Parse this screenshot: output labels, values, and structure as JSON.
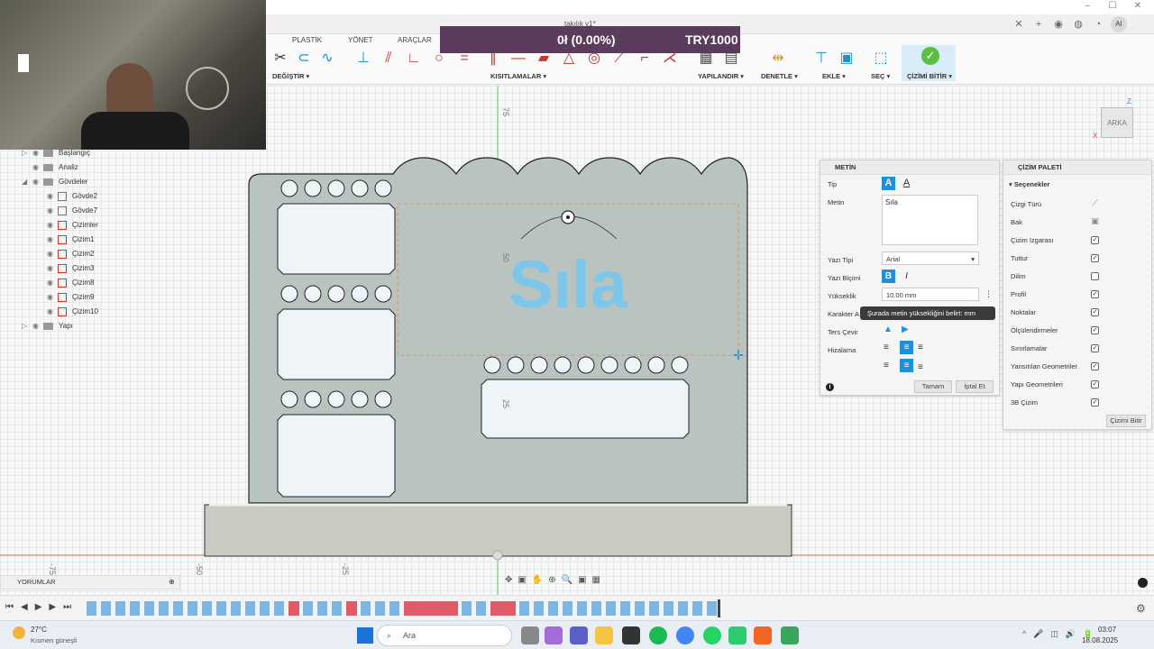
{
  "document": {
    "tab_title": "takılık v1*"
  },
  "ribbon": {
    "tabs": [
      "PLASTİK",
      "YÖNET",
      "ARAÇLAR"
    ],
    "groups": {
      "modify": "DEĞİŞTİR ▾",
      "constraints": "KISITLAMALAR ▾",
      "configure": "YAPILANDIR ▾",
      "inspect": "DENETLE ▾",
      "insert": "EKLE ▾",
      "select": "SEÇ ▾",
      "finish": "ÇİZİMİ BİTİR ▾"
    }
  },
  "banner": {
    "left": "0ł (0.00%)",
    "right": "TRY1000"
  },
  "viewcube": {
    "label": "ARKA",
    "axis_z": "Z",
    "axis_x": "X"
  },
  "browser": {
    "items": [
      {
        "label": "Başlangıç"
      },
      {
        "label": "Analiz"
      },
      {
        "label": "Gövdeler"
      },
      {
        "label": "Gövde2"
      },
      {
        "label": "Gövde7"
      },
      {
        "label": "Çizimler"
      },
      {
        "label": "Çizim1"
      },
      {
        "label": "Çizim2"
      },
      {
        "label": "Çizim3"
      },
      {
        "label": "Çizim8"
      },
      {
        "label": "Çizim9"
      },
      {
        "label": "Çizim10"
      },
      {
        "label": "Yapı"
      }
    ]
  },
  "canvas": {
    "text_preview": "Sıla",
    "dims": {
      "v75": "75",
      "v50": "50",
      "v25": "25",
      "hm75": "-75",
      "hm50": "-50",
      "hm25": "-25"
    }
  },
  "text_palette": {
    "title": "METİN",
    "type_label": "Tip",
    "text_label": "Metin",
    "text_value": "Sıla",
    "font_label": "Yazı Tipi",
    "font_value": "Arial",
    "style_label": "Yazı Biçimi",
    "bold": "B",
    "italic": "I",
    "height_label": "Yükseklik",
    "height_value": "10.00 mm",
    "char_label": "Karakter A",
    "tooltip": "Şurada metin yüksekliğini belirt: mm",
    "flip_label": "Ters Çevir",
    "align_label": "Hizalama",
    "ok": "Tamam",
    "cancel": "İptal Et"
  },
  "sketch_palette": {
    "title": "ÇİZİM PALETİ",
    "section": "Seçenekler",
    "options": [
      {
        "label": "Çizgi Türü",
        "checked": null
      },
      {
        "label": "Bak",
        "checked": null
      },
      {
        "label": "Çizim Izgarası",
        "checked": true
      },
      {
        "label": "Tuttur",
        "checked": true
      },
      {
        "label": "Dilim",
        "checked": false
      },
      {
        "label": "Profil",
        "checked": true
      },
      {
        "label": "Noktalar",
        "checked": true
      },
      {
        "label": "Ölçülendirmeler",
        "checked": true
      },
      {
        "label": "Sınırlamalar",
        "checked": true
      },
      {
        "label": "Yansıtılan Geometriler",
        "checked": true
      },
      {
        "label": "Yapı Geometrileri",
        "checked": true
      },
      {
        "label": "3B Çizim",
        "checked": true
      }
    ],
    "finish": "Çizimi Bitir"
  },
  "bottom": {
    "comments": "YORUMLAR"
  },
  "taskbar": {
    "weather_temp": "27°C",
    "weather_desc": "Kısmen güneşli",
    "search": "Ara",
    "time": "03:07",
    "date": "18.08.2025"
  },
  "colors": {
    "accent": "#1f8fd6",
    "text_preview": "#7cc6ea",
    "body_fill": "#b9c4c1",
    "banner": "#5c3c5c",
    "finish_green": "#5ac03f"
  }
}
